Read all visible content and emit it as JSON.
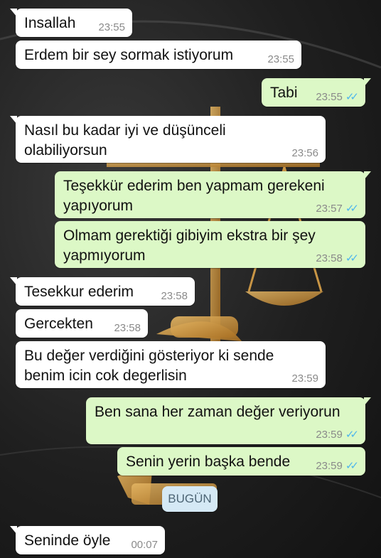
{
  "date_separator": "BUGÜN",
  "messages": [
    {
      "dir": "in",
      "text": "Insallah",
      "time": "23:55"
    },
    {
      "dir": "in",
      "text": "Erdem bir sey sormak istiyorum",
      "time": "23:55"
    },
    {
      "dir": "out",
      "text": "Tabi",
      "time": "23:55",
      "status": "read"
    },
    {
      "dir": "in",
      "text": "Nasıl bu kadar iyi ve düşünceli olabiliyorsun",
      "time": "23:56"
    },
    {
      "dir": "out",
      "text": "Teşekkür ederim ben yapmam gerekeni yapıyorum",
      "time": "23:57",
      "status": "read"
    },
    {
      "dir": "out",
      "text": "Olmam gerektiği gibiyim ekstra bir şey yapmıyorum",
      "time": "23:58",
      "status": "read"
    },
    {
      "dir": "in",
      "text": "Tesekkur ederim",
      "time": "23:58"
    },
    {
      "dir": "in",
      "text": "Gercekten",
      "time": "23:58"
    },
    {
      "dir": "in",
      "text": "Bu değer verdiğini gösteriyor ki sende benim icin cok degerlisin",
      "time": "23:59"
    },
    {
      "dir": "out",
      "text": "Ben sana her zaman değer veriyorun",
      "time": "23:59",
      "status": "read"
    },
    {
      "dir": "out",
      "text": "Senin yerin başka bende",
      "time": "23:59",
      "status": "read"
    },
    {
      "dir": "in",
      "text": "Seninde öyle",
      "time": "00:07"
    }
  ],
  "colors": {
    "incoming_bubble": "#ffffff",
    "outgoing_bubble": "#dcf8c6",
    "read_ticks": "#4fb6ec",
    "date_chip": "#d5e9f5"
  },
  "icons": {
    "read_status": "double-check-icon"
  }
}
